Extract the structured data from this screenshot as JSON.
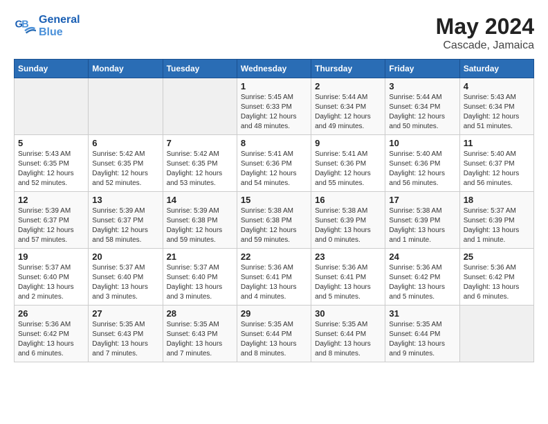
{
  "header": {
    "logo_line1": "General",
    "logo_line2": "Blue",
    "month": "May 2024",
    "location": "Cascade, Jamaica"
  },
  "weekdays": [
    "Sunday",
    "Monday",
    "Tuesday",
    "Wednesday",
    "Thursday",
    "Friday",
    "Saturday"
  ],
  "weeks": [
    [
      {
        "day": "",
        "info": ""
      },
      {
        "day": "",
        "info": ""
      },
      {
        "day": "",
        "info": ""
      },
      {
        "day": "1",
        "info": "Sunrise: 5:45 AM\nSunset: 6:33 PM\nDaylight: 12 hours\nand 48 minutes."
      },
      {
        "day": "2",
        "info": "Sunrise: 5:44 AM\nSunset: 6:34 PM\nDaylight: 12 hours\nand 49 minutes."
      },
      {
        "day": "3",
        "info": "Sunrise: 5:44 AM\nSunset: 6:34 PM\nDaylight: 12 hours\nand 50 minutes."
      },
      {
        "day": "4",
        "info": "Sunrise: 5:43 AM\nSunset: 6:34 PM\nDaylight: 12 hours\nand 51 minutes."
      }
    ],
    [
      {
        "day": "5",
        "info": "Sunrise: 5:43 AM\nSunset: 6:35 PM\nDaylight: 12 hours\nand 52 minutes."
      },
      {
        "day": "6",
        "info": "Sunrise: 5:42 AM\nSunset: 6:35 PM\nDaylight: 12 hours\nand 52 minutes."
      },
      {
        "day": "7",
        "info": "Sunrise: 5:42 AM\nSunset: 6:35 PM\nDaylight: 12 hours\nand 53 minutes."
      },
      {
        "day": "8",
        "info": "Sunrise: 5:41 AM\nSunset: 6:36 PM\nDaylight: 12 hours\nand 54 minutes."
      },
      {
        "day": "9",
        "info": "Sunrise: 5:41 AM\nSunset: 6:36 PM\nDaylight: 12 hours\nand 55 minutes."
      },
      {
        "day": "10",
        "info": "Sunrise: 5:40 AM\nSunset: 6:36 PM\nDaylight: 12 hours\nand 56 minutes."
      },
      {
        "day": "11",
        "info": "Sunrise: 5:40 AM\nSunset: 6:37 PM\nDaylight: 12 hours\nand 56 minutes."
      }
    ],
    [
      {
        "day": "12",
        "info": "Sunrise: 5:39 AM\nSunset: 6:37 PM\nDaylight: 12 hours\nand 57 minutes."
      },
      {
        "day": "13",
        "info": "Sunrise: 5:39 AM\nSunset: 6:37 PM\nDaylight: 12 hours\nand 58 minutes."
      },
      {
        "day": "14",
        "info": "Sunrise: 5:39 AM\nSunset: 6:38 PM\nDaylight: 12 hours\nand 59 minutes."
      },
      {
        "day": "15",
        "info": "Sunrise: 5:38 AM\nSunset: 6:38 PM\nDaylight: 12 hours\nand 59 minutes."
      },
      {
        "day": "16",
        "info": "Sunrise: 5:38 AM\nSunset: 6:39 PM\nDaylight: 13 hours\nand 0 minutes."
      },
      {
        "day": "17",
        "info": "Sunrise: 5:38 AM\nSunset: 6:39 PM\nDaylight: 13 hours\nand 1 minute."
      },
      {
        "day": "18",
        "info": "Sunrise: 5:37 AM\nSunset: 6:39 PM\nDaylight: 13 hours\nand 1 minute."
      }
    ],
    [
      {
        "day": "19",
        "info": "Sunrise: 5:37 AM\nSunset: 6:40 PM\nDaylight: 13 hours\nand 2 minutes."
      },
      {
        "day": "20",
        "info": "Sunrise: 5:37 AM\nSunset: 6:40 PM\nDaylight: 13 hours\nand 3 minutes."
      },
      {
        "day": "21",
        "info": "Sunrise: 5:37 AM\nSunset: 6:40 PM\nDaylight: 13 hours\nand 3 minutes."
      },
      {
        "day": "22",
        "info": "Sunrise: 5:36 AM\nSunset: 6:41 PM\nDaylight: 13 hours\nand 4 minutes."
      },
      {
        "day": "23",
        "info": "Sunrise: 5:36 AM\nSunset: 6:41 PM\nDaylight: 13 hours\nand 5 minutes."
      },
      {
        "day": "24",
        "info": "Sunrise: 5:36 AM\nSunset: 6:42 PM\nDaylight: 13 hours\nand 5 minutes."
      },
      {
        "day": "25",
        "info": "Sunrise: 5:36 AM\nSunset: 6:42 PM\nDaylight: 13 hours\nand 6 minutes."
      }
    ],
    [
      {
        "day": "26",
        "info": "Sunrise: 5:36 AM\nSunset: 6:42 PM\nDaylight: 13 hours\nand 6 minutes."
      },
      {
        "day": "27",
        "info": "Sunrise: 5:35 AM\nSunset: 6:43 PM\nDaylight: 13 hours\nand 7 minutes."
      },
      {
        "day": "28",
        "info": "Sunrise: 5:35 AM\nSunset: 6:43 PM\nDaylight: 13 hours\nand 7 minutes."
      },
      {
        "day": "29",
        "info": "Sunrise: 5:35 AM\nSunset: 6:44 PM\nDaylight: 13 hours\nand 8 minutes."
      },
      {
        "day": "30",
        "info": "Sunrise: 5:35 AM\nSunset: 6:44 PM\nDaylight: 13 hours\nand 8 minutes."
      },
      {
        "day": "31",
        "info": "Sunrise: 5:35 AM\nSunset: 6:44 PM\nDaylight: 13 hours\nand 9 minutes."
      },
      {
        "day": "",
        "info": ""
      }
    ]
  ]
}
